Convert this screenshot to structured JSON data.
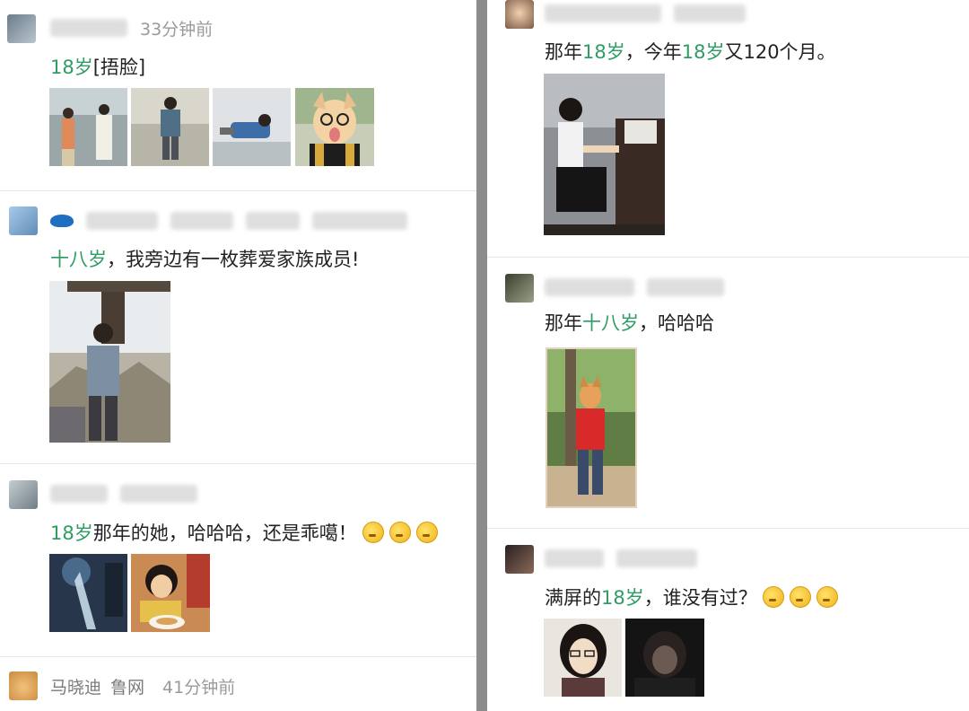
{
  "left": {
    "posts": [
      {
        "time": "33分钟前",
        "text_hl": "18岁",
        "text_rest": "[捂脸]"
      },
      {
        "text_hl": "十八岁",
        "text_rest": "，我旁边有一枚葬爱家族成员!"
      },
      {
        "text_hl": "18岁",
        "text_rest": "那年的她，哈哈哈，还是乖噶！"
      },
      {
        "name": "马晓迪",
        "source": "鲁网",
        "time": "41分钟前"
      }
    ]
  },
  "right": {
    "posts": [
      {
        "seg1": "那年",
        "hl1": "18岁",
        "seg2": "，今年",
        "hl2": "18岁",
        "seg3": "又120个月。"
      },
      {
        "seg1": "那年",
        "hl1": "十八岁",
        "seg2": "，哈哈哈"
      },
      {
        "seg1": "满屏的",
        "hl1": "18岁",
        "seg2": "，谁没有过？"
      }
    ]
  },
  "icons": {
    "emoji": "thinking-face-icon"
  }
}
